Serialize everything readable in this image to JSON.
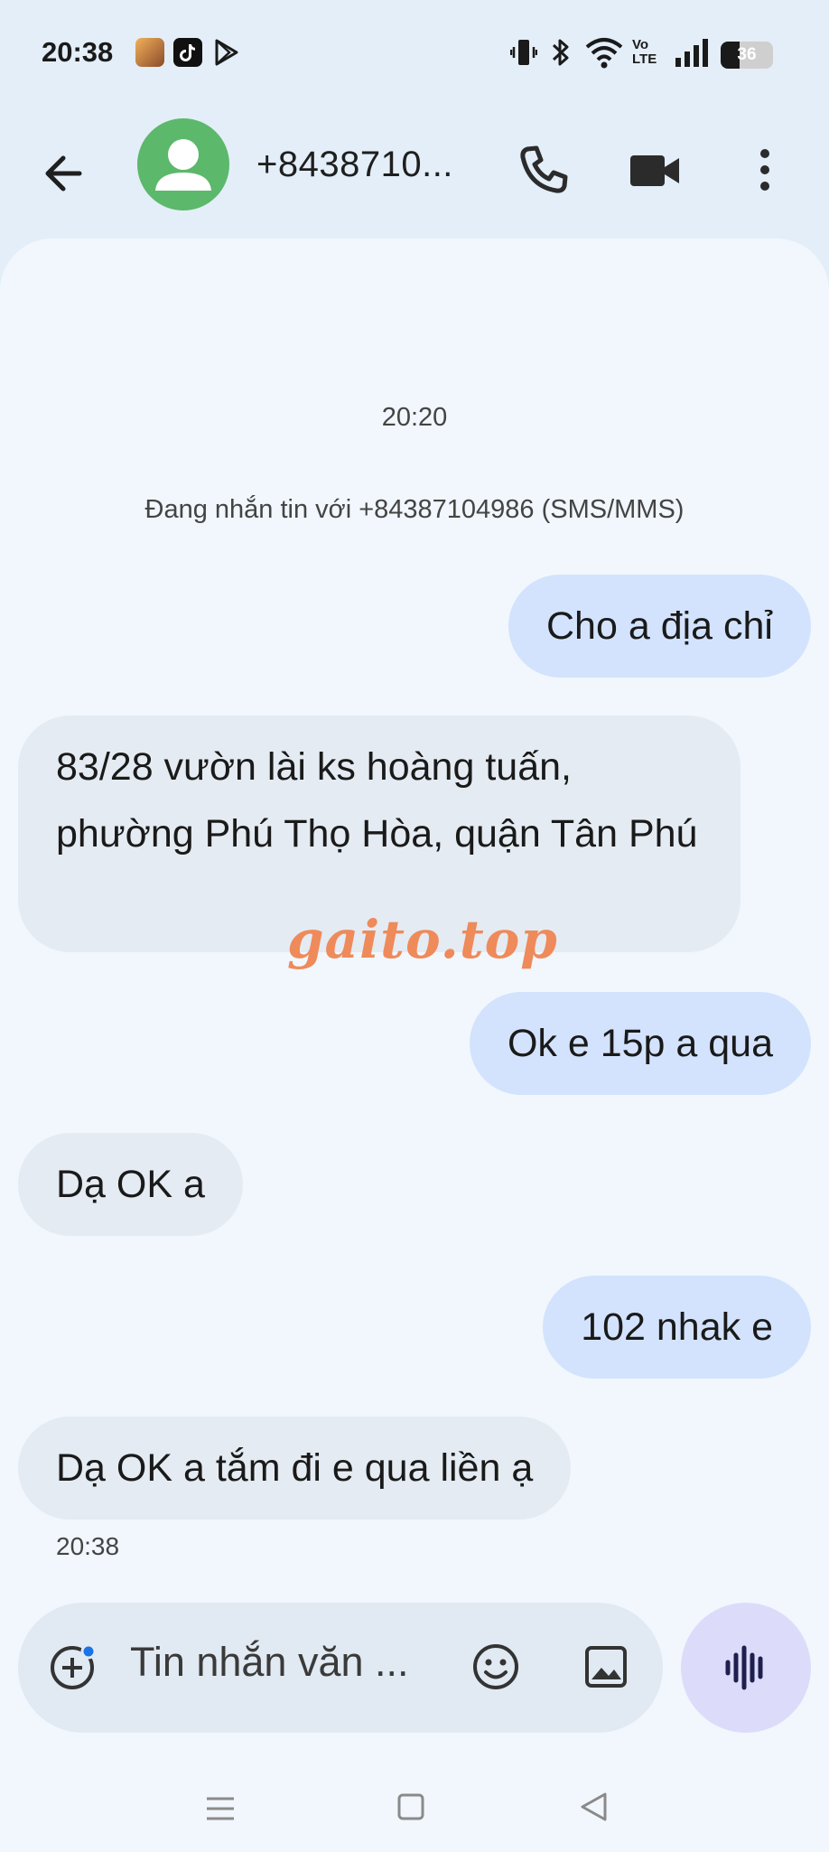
{
  "status_bar": {
    "time": "20:38",
    "network_label": "Vo\nLTE",
    "battery": "36",
    "icons": [
      "game-app-icon",
      "tiktok-icon",
      "play-store-icon",
      "vibrate-icon",
      "bluetooth-icon",
      "wifi-icon",
      "volte-icon",
      "signal-icon",
      "battery-icon"
    ]
  },
  "header": {
    "contact_name": "+8438710...",
    "icons": [
      "back-arrow-icon",
      "person-icon",
      "phone-icon",
      "video-camera-icon",
      "more-vert-icon"
    ],
    "avatar_color": "#5cb86b"
  },
  "conversation": {
    "timestamp_top": "20:20",
    "info_line": "Đang nhắn tin với +84387104986 (SMS/MMS)",
    "messages": [
      {
        "direction": "outgoing",
        "text": "Cho a địa chỉ"
      },
      {
        "direction": "incoming",
        "text": "83/28 vườn lài ks hoàng tuấn, phường Phú Thọ Hòa, quận Tân Phú"
      },
      {
        "direction": "outgoing",
        "text": "Ok e 15p a qua"
      },
      {
        "direction": "incoming",
        "text": "Dạ OK a"
      },
      {
        "direction": "outgoing",
        "text": "102 nhak e"
      },
      {
        "direction": "incoming",
        "text": "Dạ OK a tắm đi e qua liền ạ"
      }
    ],
    "timestamp_bottom": "20:38",
    "watermark": "gaito.top",
    "colors": {
      "outgoing": "#d3e3fd",
      "incoming": "#e4ebf2",
      "background": "#f1f7fd",
      "watermark": "#ef8a5a"
    }
  },
  "compose": {
    "placeholder": "Tin nhắn văn ...",
    "icons": [
      "add-icon",
      "emoji-icon",
      "image-icon",
      "voice-icon"
    ]
  },
  "nav_bar": {
    "icons": [
      "menu-icon",
      "home-icon",
      "back-triangle-icon"
    ]
  }
}
